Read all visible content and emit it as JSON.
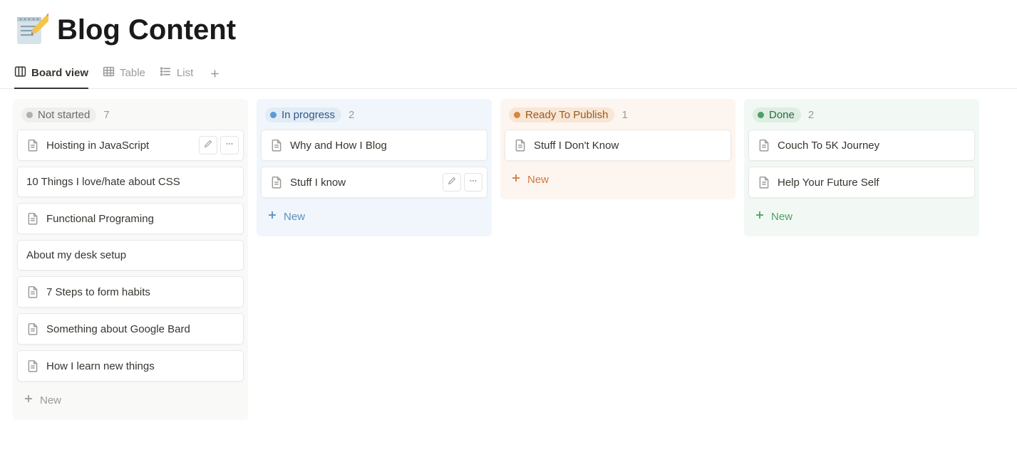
{
  "page": {
    "title": "Blog Content"
  },
  "views": {
    "board": "Board view",
    "table": "Table",
    "list": "List"
  },
  "newLabel": "New",
  "columns": [
    {
      "id": "notstarted",
      "label": "Not started",
      "count": "7",
      "tintClass": "col-notstarted",
      "pillClass": "pill-notstarted",
      "newClass": "new-notstarted",
      "cards": [
        {
          "title": "Hoisting in JavaScript",
          "hasIcon": true,
          "showActions": true
        },
        {
          "title": "10 Things I love/hate about CSS",
          "hasIcon": false
        },
        {
          "title": "Functional Programing",
          "hasIcon": true
        },
        {
          "title": "About my desk setup",
          "hasIcon": false
        },
        {
          "title": "7 Steps to form habits",
          "hasIcon": true
        },
        {
          "title": "Something about Google Bard",
          "hasIcon": true
        },
        {
          "title": "How I learn new things",
          "hasIcon": true
        }
      ]
    },
    {
      "id": "inprogress",
      "label": "In progress",
      "count": "2",
      "tintClass": "col-inprogress",
      "pillClass": "pill-inprogress",
      "newClass": "new-inprogress",
      "cards": [
        {
          "title": "Why and How I Blog",
          "hasIcon": true
        },
        {
          "title": "Stuff I know",
          "hasIcon": true,
          "showActions": true
        }
      ]
    },
    {
      "id": "ready",
      "label": "Ready To Publish",
      "count": "1",
      "tintClass": "col-ready",
      "pillClass": "pill-ready",
      "newClass": "new-ready",
      "cards": [
        {
          "title": "Stuff I Don't Know",
          "hasIcon": true
        }
      ]
    },
    {
      "id": "done",
      "label": "Done",
      "count": "2",
      "tintClass": "col-done",
      "pillClass": "pill-done",
      "newClass": "new-done",
      "cards": [
        {
          "title": "Couch To 5K Journey",
          "hasIcon": true
        },
        {
          "title": "Help Your Future Self",
          "hasIcon": true
        }
      ]
    }
  ]
}
